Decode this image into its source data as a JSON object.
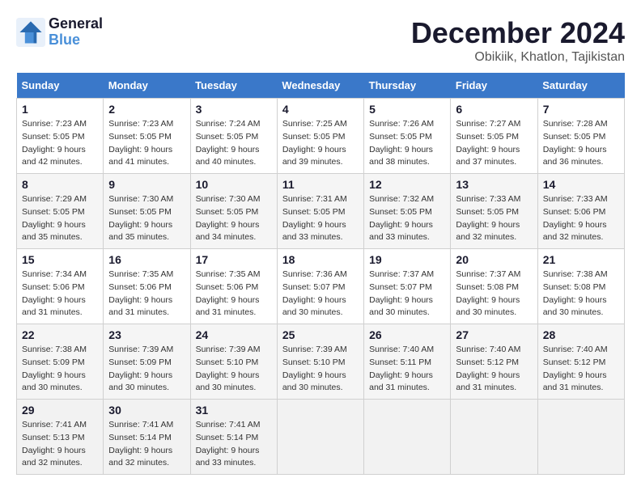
{
  "header": {
    "logo_line1": "General",
    "logo_line2": "Blue",
    "month": "December 2024",
    "location": "Obikiik, Khatlon, Tajikistan"
  },
  "weekdays": [
    "Sunday",
    "Monday",
    "Tuesday",
    "Wednesday",
    "Thursday",
    "Friday",
    "Saturday"
  ],
  "weeks": [
    [
      {
        "day": "1",
        "sunrise": "Sunrise: 7:23 AM",
        "sunset": "Sunset: 5:05 PM",
        "daylight": "Daylight: 9 hours and 42 minutes."
      },
      {
        "day": "2",
        "sunrise": "Sunrise: 7:23 AM",
        "sunset": "Sunset: 5:05 PM",
        "daylight": "Daylight: 9 hours and 41 minutes."
      },
      {
        "day": "3",
        "sunrise": "Sunrise: 7:24 AM",
        "sunset": "Sunset: 5:05 PM",
        "daylight": "Daylight: 9 hours and 40 minutes."
      },
      {
        "day": "4",
        "sunrise": "Sunrise: 7:25 AM",
        "sunset": "Sunset: 5:05 PM",
        "daylight": "Daylight: 9 hours and 39 minutes."
      },
      {
        "day": "5",
        "sunrise": "Sunrise: 7:26 AM",
        "sunset": "Sunset: 5:05 PM",
        "daylight": "Daylight: 9 hours and 38 minutes."
      },
      {
        "day": "6",
        "sunrise": "Sunrise: 7:27 AM",
        "sunset": "Sunset: 5:05 PM",
        "daylight": "Daylight: 9 hours and 37 minutes."
      },
      {
        "day": "7",
        "sunrise": "Sunrise: 7:28 AM",
        "sunset": "Sunset: 5:05 PM",
        "daylight": "Daylight: 9 hours and 36 minutes."
      }
    ],
    [
      {
        "day": "8",
        "sunrise": "Sunrise: 7:29 AM",
        "sunset": "Sunset: 5:05 PM",
        "daylight": "Daylight: 9 hours and 35 minutes."
      },
      {
        "day": "9",
        "sunrise": "Sunrise: 7:30 AM",
        "sunset": "Sunset: 5:05 PM",
        "daylight": "Daylight: 9 hours and 35 minutes."
      },
      {
        "day": "10",
        "sunrise": "Sunrise: 7:30 AM",
        "sunset": "Sunset: 5:05 PM",
        "daylight": "Daylight: 9 hours and 34 minutes."
      },
      {
        "day": "11",
        "sunrise": "Sunrise: 7:31 AM",
        "sunset": "Sunset: 5:05 PM",
        "daylight": "Daylight: 9 hours and 33 minutes."
      },
      {
        "day": "12",
        "sunrise": "Sunrise: 7:32 AM",
        "sunset": "Sunset: 5:05 PM",
        "daylight": "Daylight: 9 hours and 33 minutes."
      },
      {
        "day": "13",
        "sunrise": "Sunrise: 7:33 AM",
        "sunset": "Sunset: 5:05 PM",
        "daylight": "Daylight: 9 hours and 32 minutes."
      },
      {
        "day": "14",
        "sunrise": "Sunrise: 7:33 AM",
        "sunset": "Sunset: 5:06 PM",
        "daylight": "Daylight: 9 hours and 32 minutes."
      }
    ],
    [
      {
        "day": "15",
        "sunrise": "Sunrise: 7:34 AM",
        "sunset": "Sunset: 5:06 PM",
        "daylight": "Daylight: 9 hours and 31 minutes."
      },
      {
        "day": "16",
        "sunrise": "Sunrise: 7:35 AM",
        "sunset": "Sunset: 5:06 PM",
        "daylight": "Daylight: 9 hours and 31 minutes."
      },
      {
        "day": "17",
        "sunrise": "Sunrise: 7:35 AM",
        "sunset": "Sunset: 5:06 PM",
        "daylight": "Daylight: 9 hours and 31 minutes."
      },
      {
        "day": "18",
        "sunrise": "Sunrise: 7:36 AM",
        "sunset": "Sunset: 5:07 PM",
        "daylight": "Daylight: 9 hours and 30 minutes."
      },
      {
        "day": "19",
        "sunrise": "Sunrise: 7:37 AM",
        "sunset": "Sunset: 5:07 PM",
        "daylight": "Daylight: 9 hours and 30 minutes."
      },
      {
        "day": "20",
        "sunrise": "Sunrise: 7:37 AM",
        "sunset": "Sunset: 5:08 PM",
        "daylight": "Daylight: 9 hours and 30 minutes."
      },
      {
        "day": "21",
        "sunrise": "Sunrise: 7:38 AM",
        "sunset": "Sunset: 5:08 PM",
        "daylight": "Daylight: 9 hours and 30 minutes."
      }
    ],
    [
      {
        "day": "22",
        "sunrise": "Sunrise: 7:38 AM",
        "sunset": "Sunset: 5:09 PM",
        "daylight": "Daylight: 9 hours and 30 minutes."
      },
      {
        "day": "23",
        "sunrise": "Sunrise: 7:39 AM",
        "sunset": "Sunset: 5:09 PM",
        "daylight": "Daylight: 9 hours and 30 minutes."
      },
      {
        "day": "24",
        "sunrise": "Sunrise: 7:39 AM",
        "sunset": "Sunset: 5:10 PM",
        "daylight": "Daylight: 9 hours and 30 minutes."
      },
      {
        "day": "25",
        "sunrise": "Sunrise: 7:39 AM",
        "sunset": "Sunset: 5:10 PM",
        "daylight": "Daylight: 9 hours and 30 minutes."
      },
      {
        "day": "26",
        "sunrise": "Sunrise: 7:40 AM",
        "sunset": "Sunset: 5:11 PM",
        "daylight": "Daylight: 9 hours and 31 minutes."
      },
      {
        "day": "27",
        "sunrise": "Sunrise: 7:40 AM",
        "sunset": "Sunset: 5:12 PM",
        "daylight": "Daylight: 9 hours and 31 minutes."
      },
      {
        "day": "28",
        "sunrise": "Sunrise: 7:40 AM",
        "sunset": "Sunset: 5:12 PM",
        "daylight": "Daylight: 9 hours and 31 minutes."
      }
    ],
    [
      {
        "day": "29",
        "sunrise": "Sunrise: 7:41 AM",
        "sunset": "Sunset: 5:13 PM",
        "daylight": "Daylight: 9 hours and 32 minutes."
      },
      {
        "day": "30",
        "sunrise": "Sunrise: 7:41 AM",
        "sunset": "Sunset: 5:14 PM",
        "daylight": "Daylight: 9 hours and 32 minutes."
      },
      {
        "day": "31",
        "sunrise": "Sunrise: 7:41 AM",
        "sunset": "Sunset: 5:14 PM",
        "daylight": "Daylight: 9 hours and 33 minutes."
      },
      null,
      null,
      null,
      null
    ]
  ]
}
